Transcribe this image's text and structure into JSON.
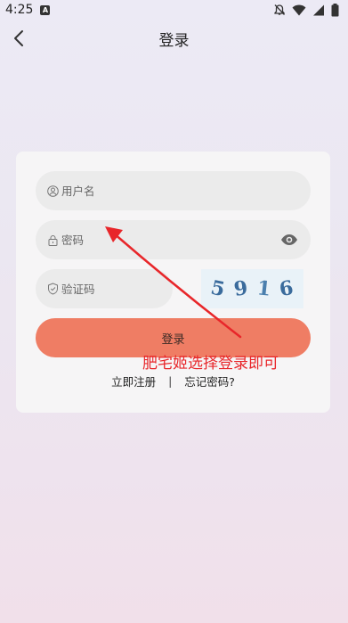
{
  "status_bar": {
    "time": "4:25",
    "notification_badge": "A"
  },
  "header": {
    "title": "登录"
  },
  "form": {
    "username_placeholder": "用户名",
    "password_placeholder": "密码",
    "captcha_placeholder": "验证码",
    "captcha_digits": [
      "5",
      "9",
      "1",
      "6"
    ],
    "login_button": "登录",
    "register_link": "立即注册",
    "separator": "|",
    "forgot_link": "忘记密码?"
  },
  "annotation": {
    "text": "肥宅姬选择登录即可",
    "color": "#e8262a"
  },
  "colors": {
    "accent": "#ef7d64"
  }
}
